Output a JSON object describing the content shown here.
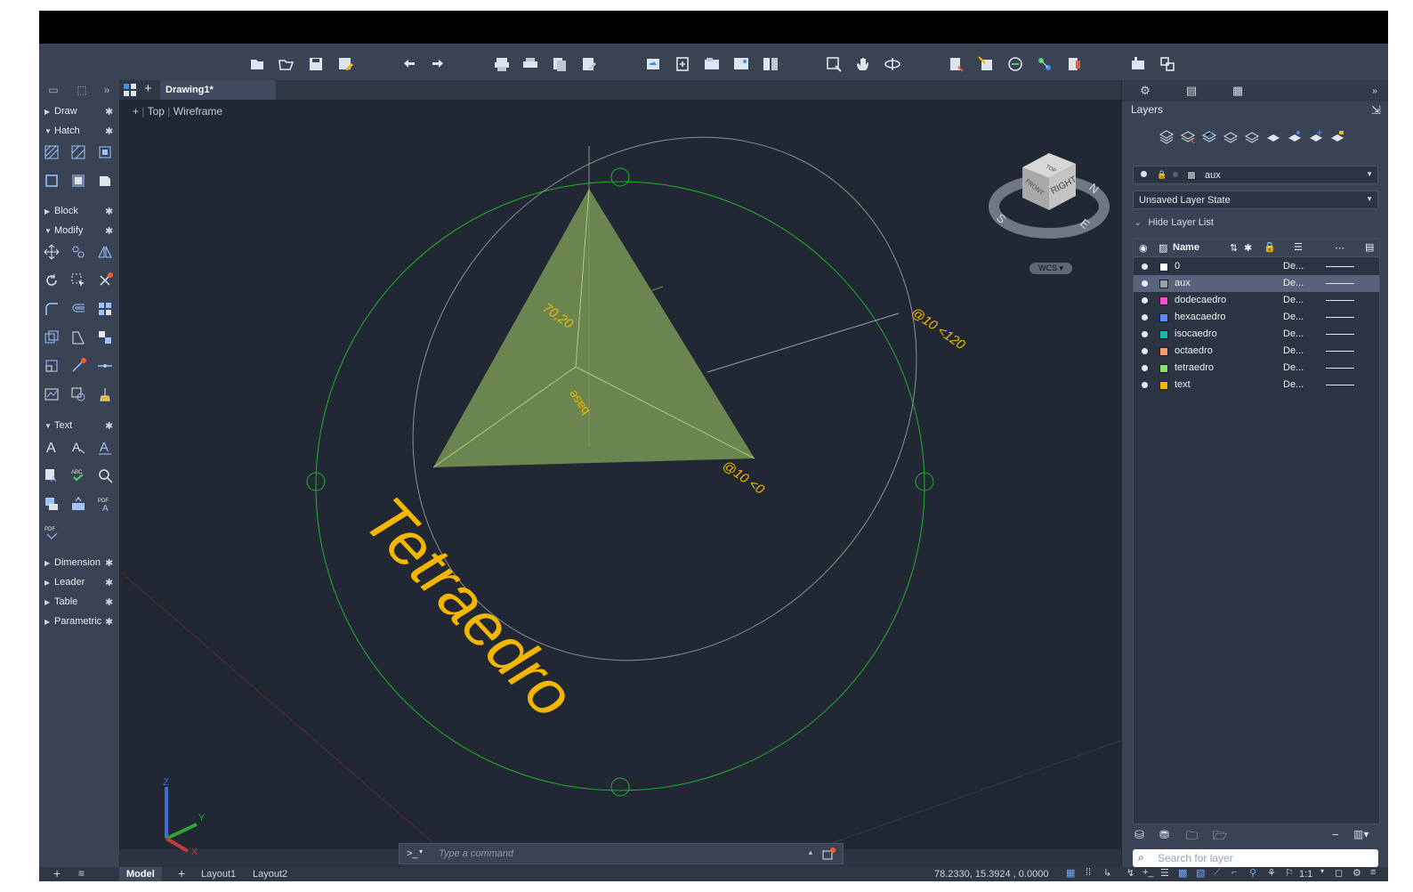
{
  "file_tab": {
    "title": "Drawing1*"
  },
  "viewport": {
    "plus": "+",
    "view": "Top",
    "style": "Wireframe"
  },
  "palette": {
    "sections": [
      {
        "label": "Draw",
        "expanded": false
      },
      {
        "label": "Hatch",
        "expanded": true
      },
      {
        "label": "Block",
        "expanded": false
      },
      {
        "label": "Modify",
        "expanded": true
      },
      {
        "label": "Text",
        "expanded": true
      },
      {
        "label": "Dimension",
        "expanded": false
      },
      {
        "label": "Leader",
        "expanded": false
      },
      {
        "label": "Table",
        "expanded": false
      },
      {
        "label": "Parametric",
        "expanded": false
      }
    ]
  },
  "drawing": {
    "title_text": "Tetraedro",
    "dim_70_20": "70,20",
    "dim_10_120": "@10 <120",
    "dim_10_0": "@10 <0",
    "base_label": "base",
    "fill_color": "#7a9a56",
    "annotation_color": "#f2b600"
  },
  "viewcube": {
    "top": "TOP",
    "front": "FRONT",
    "right": "RIGHT",
    "n": "N",
    "e": "E",
    "s": "S",
    "wcs": "WCS"
  },
  "ucs": {
    "x": "X",
    "y": "Y",
    "z": "Z"
  },
  "layers_panel": {
    "title": "Layers",
    "current_layer": "aux",
    "layer_state": "Unsaved Layer State",
    "hide_list_label": "Hide Layer List",
    "column_name": "Name",
    "rows": [
      {
        "name": "0",
        "desc": "De...",
        "color": "#ffffff",
        "selected": false
      },
      {
        "name": "aux",
        "desc": "De...",
        "color": "#9aa0a8",
        "selected": true
      },
      {
        "name": "dodecaedro",
        "desc": "De...",
        "color": "#ff4fd1",
        "selected": false
      },
      {
        "name": "hexacaedro",
        "desc": "De...",
        "color": "#5a8cff",
        "selected": false
      },
      {
        "name": "isocaedro",
        "desc": "De...",
        "color": "#19b8a8",
        "selected": false
      },
      {
        "name": "octaedro",
        "desc": "De...",
        "color": "#ff9a6a",
        "selected": false
      },
      {
        "name": "tetraedro",
        "desc": "De...",
        "color": "#8ee06a",
        "selected": false
      },
      {
        "name": "text",
        "desc": "De...",
        "color": "#f2b600",
        "selected": false
      }
    ],
    "search_placeholder": "Search for layer"
  },
  "command": {
    "prompt": ">_",
    "placeholder": "Type a command"
  },
  "status": {
    "tabs": [
      "Model",
      "Layout1",
      "Layout2"
    ],
    "coords": "78.2330, 15.3924 , 0.0000",
    "scale": "1:1"
  }
}
